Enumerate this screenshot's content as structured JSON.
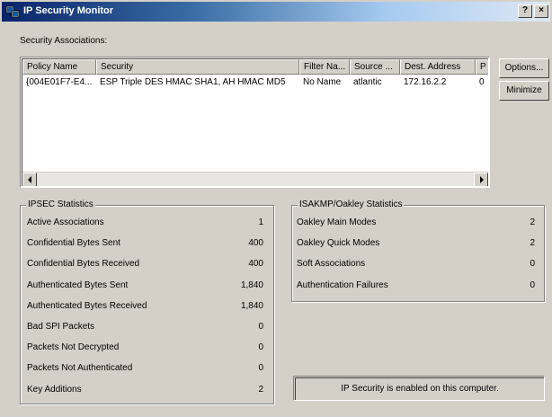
{
  "window": {
    "title": "IP Security Monitor",
    "help_label": "?",
    "close_label": "×"
  },
  "section_label": "Security Associations:",
  "list": {
    "columns": [
      "Policy Name",
      "Security",
      "Filter Na...",
      "Source ...",
      "Dest. Address",
      "P"
    ],
    "rows": [
      [
        "{004E01F7-E4...",
        "ESP Triple DES HMAC SHA1, AH HMAC MD5",
        "No Name",
        "atlantic",
        "172.16.2.2",
        "0"
      ]
    ]
  },
  "buttons": {
    "options": "Options...",
    "minimize": "Minimize"
  },
  "ipsec": {
    "title": "IPSEC Statistics",
    "rows": [
      {
        "label": "Active Associations",
        "value": "1"
      },
      {
        "label": "Confidential Bytes Sent",
        "value": "400"
      },
      {
        "label": "Confidential Bytes Received",
        "value": "400"
      },
      {
        "label": "Authenticated Bytes Sent",
        "value": "1,840"
      },
      {
        "label": "Authenticated Bytes Received",
        "value": "1,840"
      },
      {
        "label": "Bad SPI Packets",
        "value": "0"
      },
      {
        "label": "Packets Not Decrypted",
        "value": "0"
      },
      {
        "label": "Packets Not Authenticated",
        "value": "0"
      },
      {
        "label": "Key Additions",
        "value": "2"
      }
    ]
  },
  "isakmp": {
    "title": "ISAKMP/Oakley Statistics",
    "rows": [
      {
        "label": "Oakley Main Modes",
        "value": "2"
      },
      {
        "label": "Oakley Quick Modes",
        "value": "2"
      },
      {
        "label": "Soft Associations",
        "value": "0"
      },
      {
        "label": "Authentication Failures",
        "value": "0"
      }
    ]
  },
  "status": "IP Security is enabled on this computer."
}
